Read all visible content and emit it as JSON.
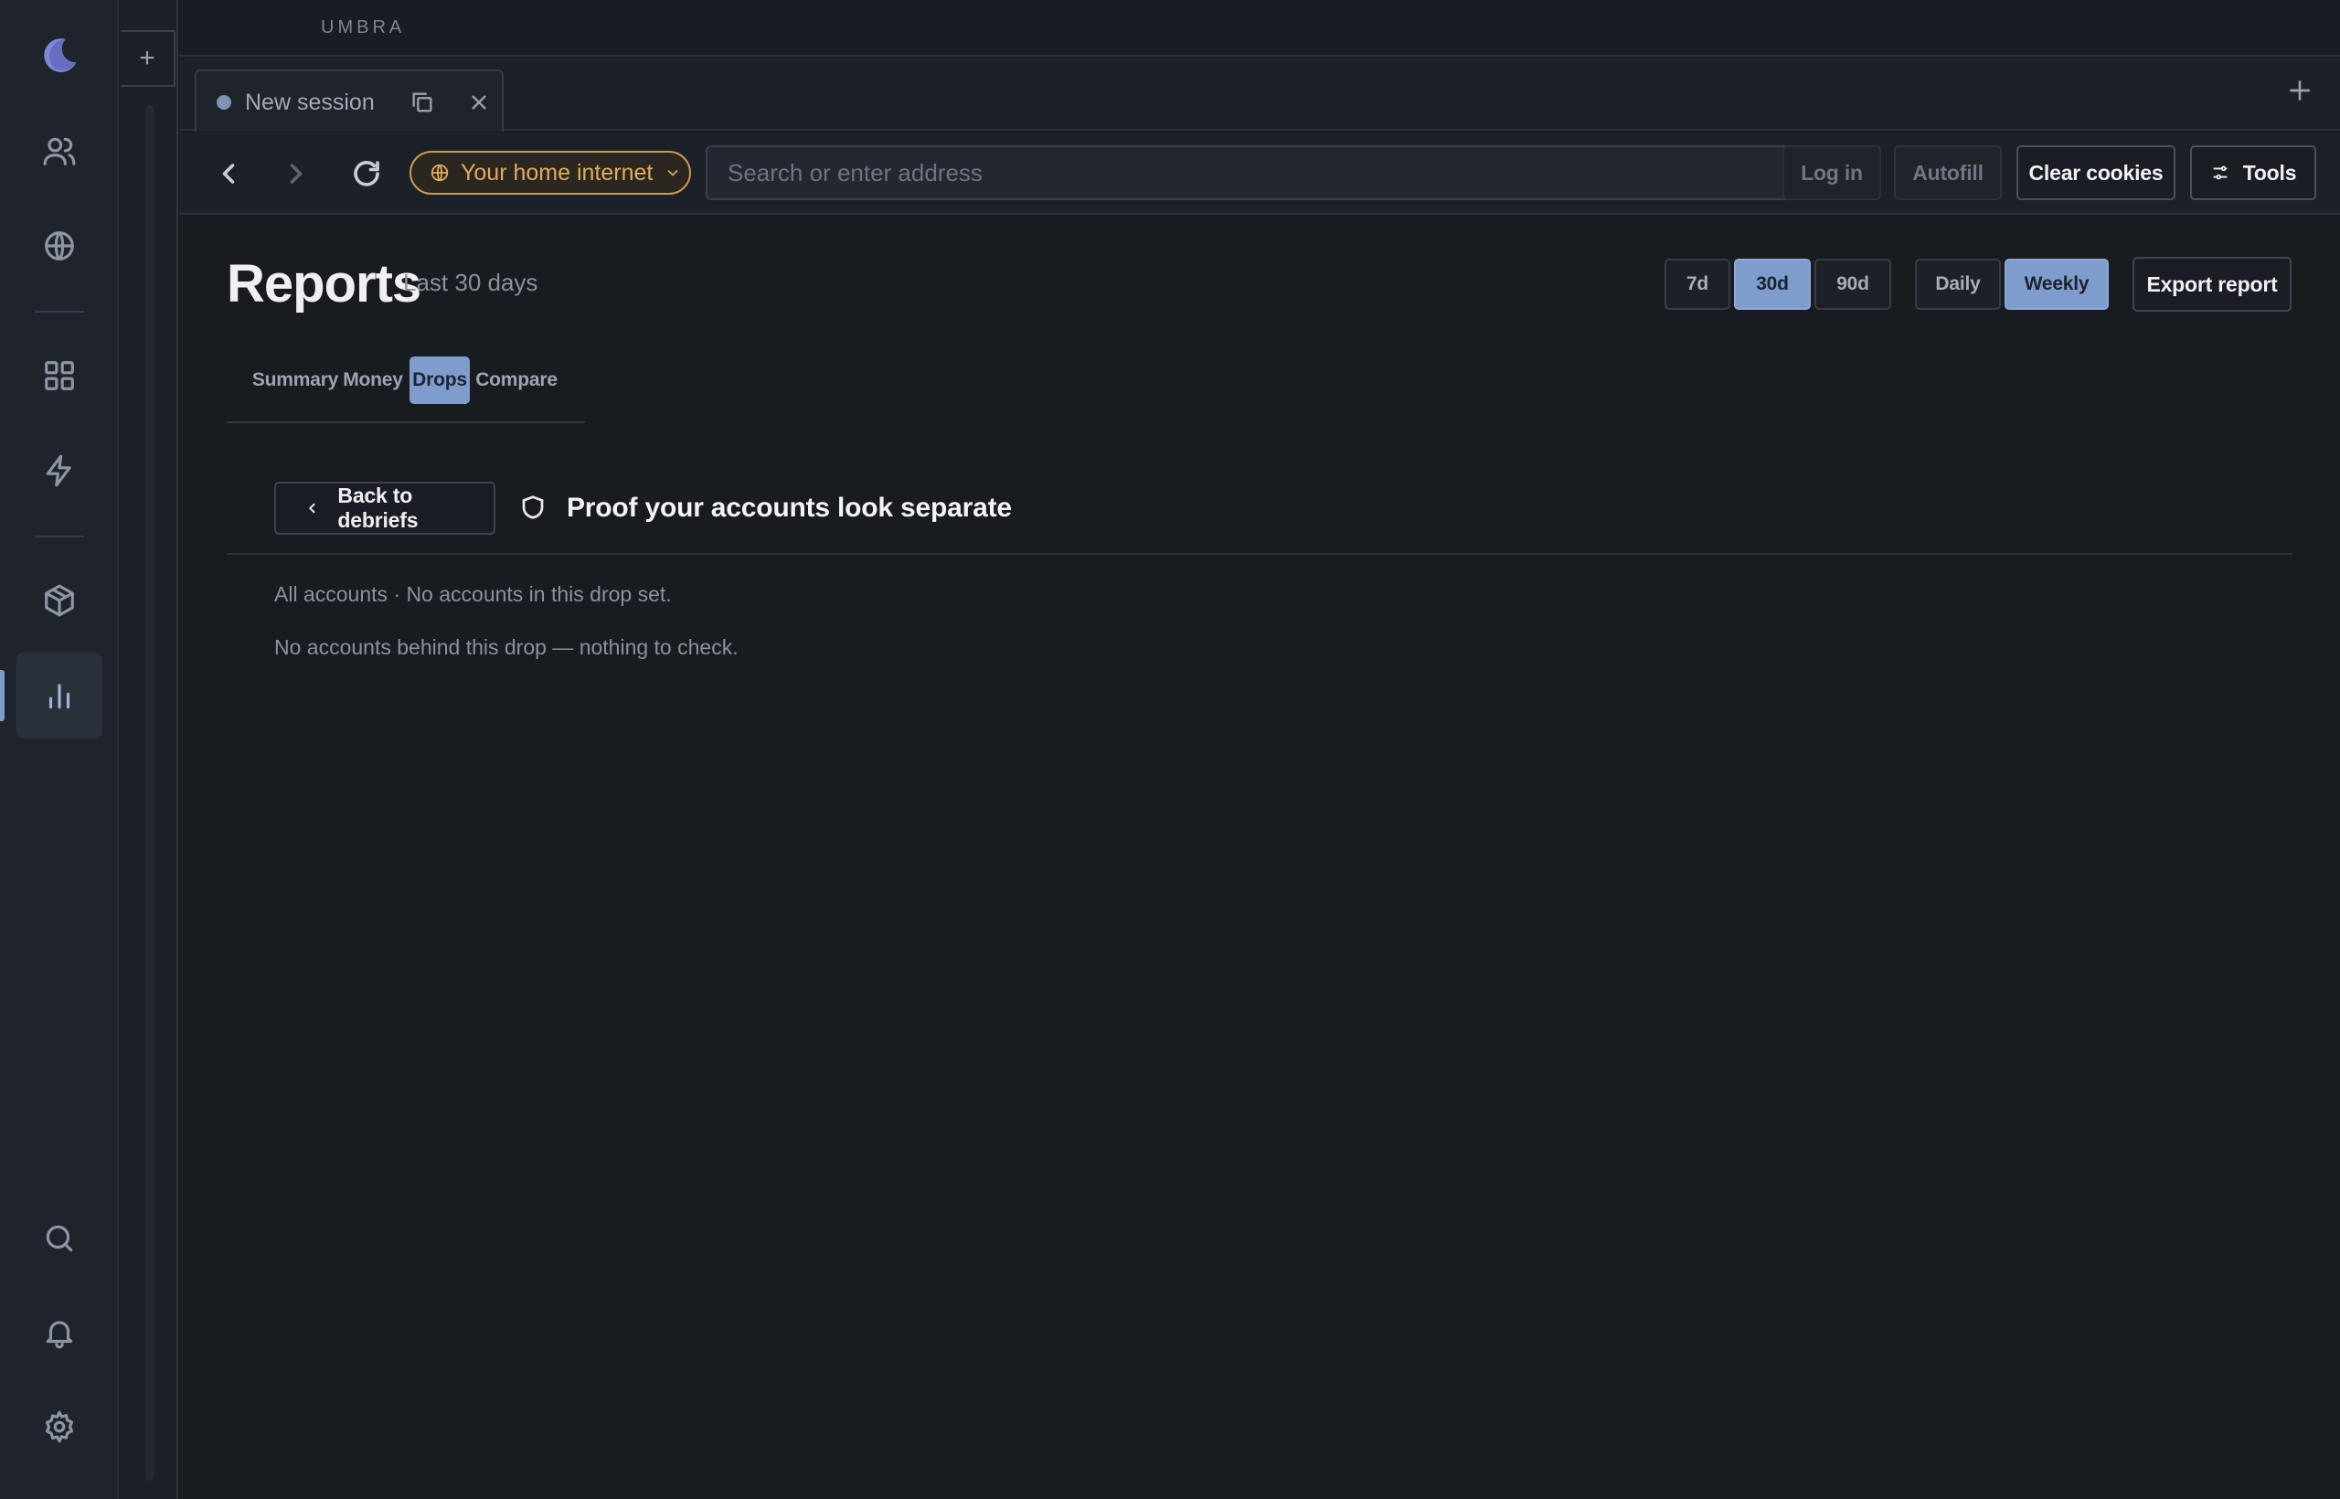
{
  "app": {
    "brand": "UMBRA"
  },
  "rail": {
    "items": [
      {
        "icon": "moon-logo-icon"
      },
      {
        "icon": "users-icon"
      },
      {
        "icon": "globe-icon"
      },
      {
        "icon": "grid-icon"
      },
      {
        "icon": "lightning-icon"
      },
      {
        "icon": "package-icon"
      },
      {
        "icon": "bar-chart-icon",
        "active": true
      },
      {
        "icon": "search-icon"
      },
      {
        "icon": "bell-icon"
      },
      {
        "icon": "gear-icon"
      }
    ]
  },
  "strip": {
    "add_label": "+"
  },
  "tab": {
    "title": "New session"
  },
  "navbar": {
    "network_label": "Your home internet",
    "address_placeholder": "Search or enter address",
    "login_label": "Log in",
    "autofill_label": "Autofill",
    "clear_cookies_label": "Clear cookies",
    "tools_label": "Tools"
  },
  "page": {
    "title": "Reports",
    "subtitle": "Last 30 days",
    "range_options": [
      "7d",
      "30d",
      "90d"
    ],
    "range_selected": "30d",
    "granularity_options": [
      "Daily",
      "Weekly"
    ],
    "granularity_selected": "Weekly",
    "export_label": "Export report",
    "tabs": [
      "Summary",
      "Money",
      "Drops",
      "Compare"
    ],
    "tab_selected": "Drops"
  },
  "section": {
    "back_label": "Back to debriefs",
    "title": "Proof your accounts look separate",
    "meta": "All accounts · No accounts in this drop set.",
    "empty": "No accounts behind this drop — nothing to check."
  },
  "colors": {
    "accent": "#7f9dcc",
    "network_warning": "#e0ad5c",
    "background": "#181b20"
  }
}
